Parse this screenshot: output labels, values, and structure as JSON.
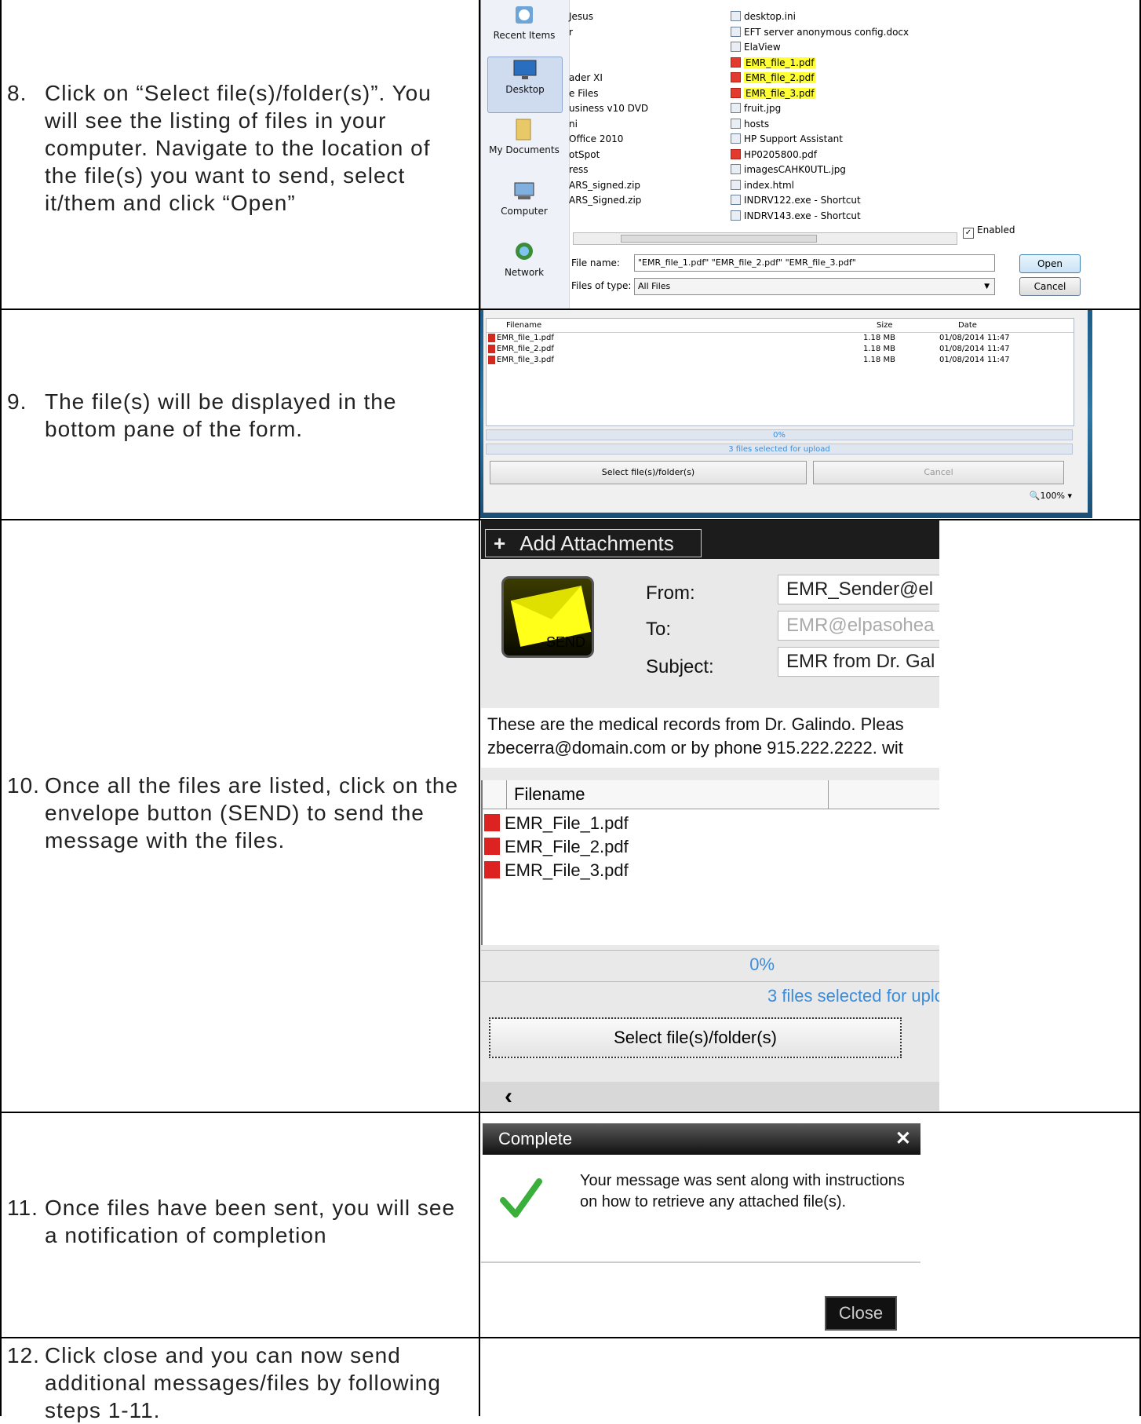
{
  "steps": [
    {
      "num": "8.",
      "text": "Click on “Select file(s)/folder(s)”. You will see the listing of files in your computer. Navigate to the location of the file(s) you want to send, select it/them and click “Open”"
    },
    {
      "num": "9.",
      "text": "The file(s) will be displayed in the bottom pane of the form."
    },
    {
      "num": "10.",
      "text": "Once all the files are listed, click on the envelope button (SEND) to send the message with the files."
    },
    {
      "num": "11.",
      "text": "Once files have been sent, you will see a notification of completion"
    },
    {
      "num": "12.",
      "text": "Click close and you can now send additional messages/files by following steps 1-11."
    }
  ],
  "file_dialog": {
    "places": [
      "Recent Items",
      "Desktop",
      "My Documents",
      "Computer",
      "Network"
    ],
    "left_column": [
      "Jesus",
      "r",
      "",
      "",
      "ader XI",
      "e Files",
      "usiness v10 DVD",
      "ni",
      "Office 2010",
      "otSpot",
      "ress",
      "ARS_signed.zip",
      "ARS_Signed.zip"
    ],
    "right_column": [
      {
        "name": "desktop.ini",
        "icon": "ini-icon",
        "hl": false
      },
      {
        "name": "EFT server anonymous config.docx",
        "icon": "docx-icon",
        "hl": false
      },
      {
        "name": "ElaView",
        "icon": "app-icon",
        "hl": false
      },
      {
        "name": "EMR_file_1.pdf",
        "icon": "pdf-icon",
        "hl": true
      },
      {
        "name": "EMR_file_2.pdf",
        "icon": "pdf-icon",
        "hl": true
      },
      {
        "name": "EMR_file_3.pdf",
        "icon": "pdf-icon",
        "hl": true
      },
      {
        "name": "fruit.jpg",
        "icon": "image-icon",
        "hl": false
      },
      {
        "name": "hosts",
        "icon": "file-icon",
        "hl": false
      },
      {
        "name": "HP Support Assistant",
        "icon": "help-icon",
        "hl": false
      },
      {
        "name": "HP0205800.pdf",
        "icon": "pdf-icon",
        "hl": false
      },
      {
        "name": "imagesCAHK0UTL.jpg",
        "icon": "image-icon",
        "hl": false
      },
      {
        "name": "index.html",
        "icon": "html-icon",
        "hl": false
      },
      {
        "name": "INDRV122.exe - Shortcut",
        "icon": "shortcut-icon",
        "hl": false
      },
      {
        "name": "INDRV143.exe - Shortcut",
        "icon": "shortcut-icon",
        "hl": false
      }
    ],
    "enabled_label": "Enabled",
    "file_name_label": "File name:",
    "file_name_value": "\"EMR_file_1.pdf\" \"EMR_file_2.pdf\" \"EMR_file_3.pdf\"",
    "files_of_type_label": "Files of type:",
    "files_of_type_value": "All Files",
    "open_label": "Open",
    "cancel_label": "Cancel"
  },
  "upload_pane": {
    "col_filename": "Filename",
    "col_size": "Size",
    "col_date": "Date",
    "rows": [
      {
        "name": "EMR_file_1.pdf",
        "size": "1.18 MB",
        "date": "01/08/2014 11:47"
      },
      {
        "name": "EMR_file_2.pdf",
        "size": "1.18 MB",
        "date": "01/08/2014 11:47"
      },
      {
        "name": "EMR_file_3.pdf",
        "size": "1.18 MB",
        "date": "01/08/2014 11:47"
      }
    ],
    "progress": "0%",
    "selected": "3 files selected for upload",
    "select_button": "Select file(s)/folder(s)",
    "cancel_button": "Cancel",
    "zoom": "100%"
  },
  "compose": {
    "add_attachments": "Add Attachments",
    "send_label": "SEND",
    "from_label": "From:",
    "from_value": "EMR_Sender@el",
    "to_label": "To:",
    "to_value": "EMR@elpasohea",
    "subject_label": "Subject:",
    "subject_value": "EMR from Dr. Gal",
    "message_line1": "These are the medical records from Dr. Galindo. Pleas",
    "message_line2": "zbecerra@domain.com or by phone 915.222.2222. wit",
    "col_filename": "Filename",
    "files": [
      "EMR_File_1.pdf",
      "EMR_File_2.pdf",
      "EMR_File_3.pdf"
    ],
    "progress": "0%",
    "selected": "3 files selected for uplo",
    "select_button": "Select file(s)/folder(s)"
  },
  "complete_dialog": {
    "title": "Complete",
    "message": "Your message was sent along with instructions on how to retrieve any attached file(s).",
    "close_label": "Close"
  }
}
